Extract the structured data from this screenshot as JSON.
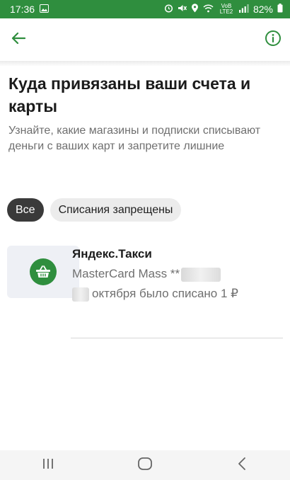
{
  "status_bar": {
    "time": "17:36",
    "network": "VoB LTE2",
    "battery": "82%"
  },
  "colors": {
    "accent": "#2f8e3e",
    "chip_active_bg": "#3a3a3a",
    "chip_inactive_bg": "#ececec",
    "muted_text": "#6f6f6f"
  },
  "toolbar": {
    "back_icon": "arrow-left-icon",
    "info_icon": "info-circle-icon"
  },
  "page": {
    "title": "Куда привязаны ваши счета и карты",
    "subtitle": "Узнайте, какие магазины и подписки списывают деньги с ваших карт и запретите лишние"
  },
  "filters": {
    "all_label": "Все",
    "blocked_label": "Списания запрещены",
    "selected": "Все"
  },
  "subscriptions": [
    {
      "icon": "basket-icon",
      "name": "Яндекс.Такси",
      "card": "MasterCard Mass **",
      "date_text": "октября было списано 1 ₽"
    }
  ],
  "nav_bar": {
    "recents_icon": "recents-icon",
    "home_icon": "home-icon",
    "back_icon": "back-chevron-icon"
  }
}
